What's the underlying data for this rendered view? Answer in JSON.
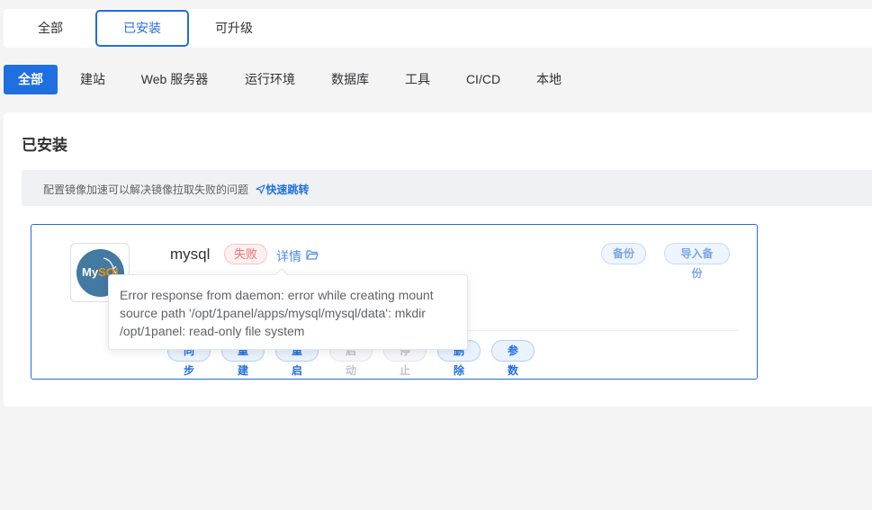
{
  "top_tabs": [
    {
      "label": "全部",
      "active": false
    },
    {
      "label": "已安装",
      "active": true
    },
    {
      "label": "可升级",
      "active": false
    }
  ],
  "categories": [
    {
      "label": "全部",
      "active": true
    },
    {
      "label": "建站",
      "active": false
    },
    {
      "label": "Web 服务器",
      "active": false
    },
    {
      "label": "运行环境",
      "active": false
    },
    {
      "label": "数据库",
      "active": false
    },
    {
      "label": "工具",
      "active": false
    },
    {
      "label": "CI/CD",
      "active": false
    },
    {
      "label": "本地",
      "active": false
    }
  ],
  "panel": {
    "title": "已安装",
    "notice_text": "配置镜像加速可以解决镜像拉取失败的问题",
    "notice_link": "快速跳转"
  },
  "app_card": {
    "name": "mysql",
    "logo_text_a": "My",
    "logo_text_b": "SQL",
    "status": "失败",
    "detail_label": "详情",
    "top_actions": [
      "备份",
      "导入备份"
    ],
    "bottom_actions": [
      {
        "label": "同步",
        "disabled": false
      },
      {
        "label": "重建",
        "disabled": false
      },
      {
        "label": "重启",
        "disabled": false
      },
      {
        "label": "启动",
        "disabled": true
      },
      {
        "label": "停止",
        "disabled": true
      },
      {
        "label": "删除",
        "disabled": false
      },
      {
        "label": "参数",
        "disabled": false
      }
    ]
  },
  "tooltip": {
    "line1": "Error response from daemon: error while creating mount",
    "line2": "source path '/opt/1panel/apps/mysql/mysql/data': mkdir",
    "line3": "/opt/1panel: read-only file system"
  },
  "colors": {
    "primary": "#1f6fe0",
    "danger": "#f56c6c",
    "mysql_blue": "#4479a1",
    "mysql_orange": "#f29111"
  },
  "icons": [
    "send-icon",
    "folder-open-icon",
    "mysql-dolphin-logo"
  ]
}
